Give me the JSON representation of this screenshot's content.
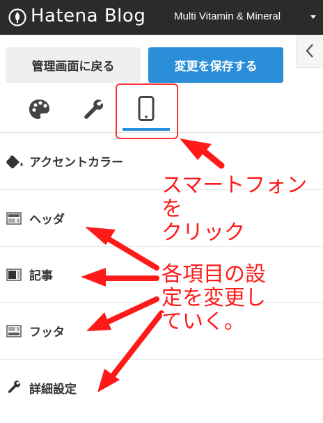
{
  "header": {
    "logo_text": "Hatena Blog",
    "blog_name": "Multi Vitamin & Mineral"
  },
  "actions": {
    "back_label": "管理画面に戻る",
    "save_label": "変更を保存する"
  },
  "tabs": [
    {
      "icon": "palette-icon",
      "name": "design"
    },
    {
      "icon": "wrench-icon",
      "name": "customize"
    },
    {
      "icon": "smartphone-icon",
      "name": "smartphone",
      "active": true
    }
  ],
  "menu": {
    "items": [
      {
        "label": "アクセントカラー",
        "icon": "paint-bucket-icon"
      },
      {
        "label": "ヘッダ",
        "icon": "layout-header-icon"
      },
      {
        "label": "記事",
        "icon": "layout-article-icon"
      },
      {
        "label": "フッタ",
        "icon": "layout-footer-icon"
      },
      {
        "label": "詳細設定",
        "icon": "wrench-icon"
      }
    ]
  },
  "annotations": {
    "tap_smartphone_line1": "スマートフォンを",
    "tap_smartphone_line2": "クリック",
    "change_each_line1": "各項目の設",
    "change_each_line2": "定を変更し",
    "change_each_line3": "ていく。"
  },
  "colors": {
    "header_bg": "#2b2b2b",
    "accent_blue": "#2a8fd8",
    "annotation_red": "#ff1a1a"
  }
}
